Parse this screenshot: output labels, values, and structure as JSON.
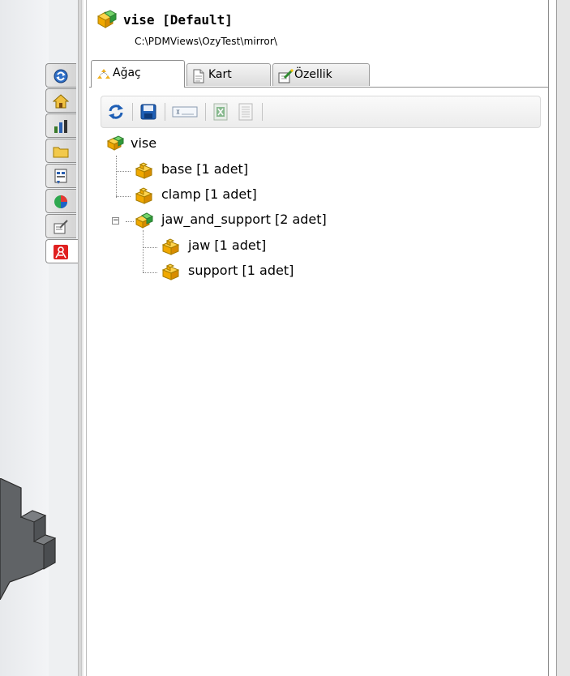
{
  "document": {
    "title": "vise [Default]",
    "path": "C:\\PDMViews\\OzyTest\\mirror\\"
  },
  "tabs": [
    {
      "label": "Ağaç",
      "icon": "tree-icon",
      "active": true
    },
    {
      "label": "Kart",
      "icon": "card-icon",
      "active": false
    },
    {
      "label": "Özellik",
      "icon": "properties-icon",
      "active": false
    }
  ],
  "toolbar": {
    "buttons": [
      {
        "icon": "refresh-icon"
      },
      {
        "icon": "save-icon"
      },
      {
        "icon": "textbox-icon"
      },
      {
        "icon": "excel-export-icon"
      },
      {
        "icon": "list-icon"
      }
    ]
  },
  "side_tabs": [
    {
      "icon": "pdm-logo-icon"
    },
    {
      "icon": "home-icon"
    },
    {
      "icon": "chart-icon"
    },
    {
      "icon": "folder-icon"
    },
    {
      "icon": "report-icon"
    },
    {
      "icon": "appearance-icon"
    },
    {
      "icon": "property-manager-icon"
    },
    {
      "icon": "ozy-pdm-icon"
    }
  ],
  "tree": {
    "root": {
      "label": "vise",
      "icon": "assembly-icon"
    },
    "children": [
      {
        "label": "base [1 adet]",
        "icon": "part-icon"
      },
      {
        "label": "clamp [1 adet]",
        "icon": "part-icon"
      },
      {
        "label": "jaw_and_support [2 adet]",
        "icon": "assembly-icon",
        "expanded": true,
        "children": [
          {
            "label": "jaw [1 adet]",
            "icon": "part-icon"
          },
          {
            "label": "support [1 adet]",
            "icon": "part-icon"
          }
        ]
      }
    ]
  },
  "colors": {
    "assembly_green": "#39b54a",
    "part_yellow": "#f5b400",
    "accent_blue": "#1f5fb5"
  }
}
